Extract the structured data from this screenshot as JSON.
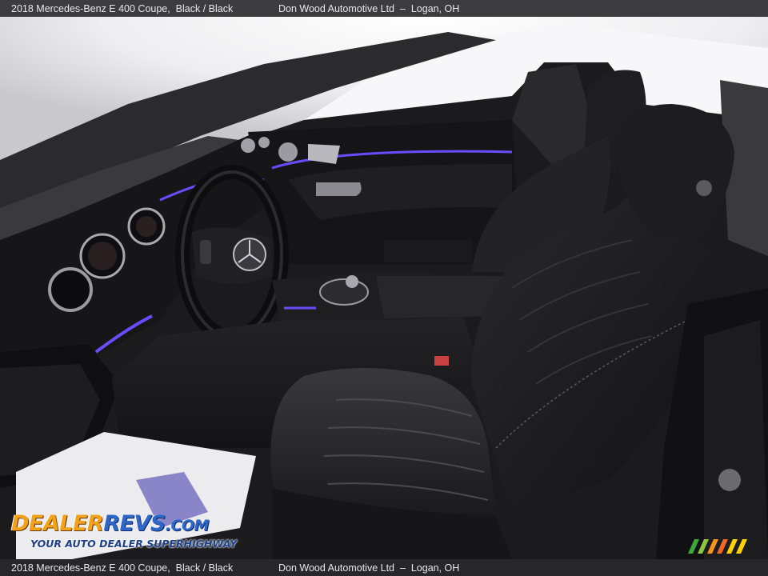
{
  "header": {
    "vehicle": "2018 Mercedes-Benz E 400 Coupe,  Black / Black",
    "dealer": "Don Wood Automotive Ltd  –  Logan, OH"
  },
  "footer": {
    "vehicle": "2018 Mercedes-Benz E 400 Coupe,  Black / Black",
    "dealer": "Don Wood Automotive Ltd  –  Logan, OH"
  },
  "watermark": {
    "brand_part1": "DEALER",
    "brand_part2": "REVS",
    "brand_part3": ".COM",
    "tagline": "YOUR AUTO DEALER SUPERHIGHWAY"
  },
  "photo": {
    "subject": "front-interior-driver-side",
    "colors": {
      "leather": "#1c1c1e",
      "ambient_light": "#6a4cff",
      "window_glare": "#f4f4f6"
    }
  }
}
